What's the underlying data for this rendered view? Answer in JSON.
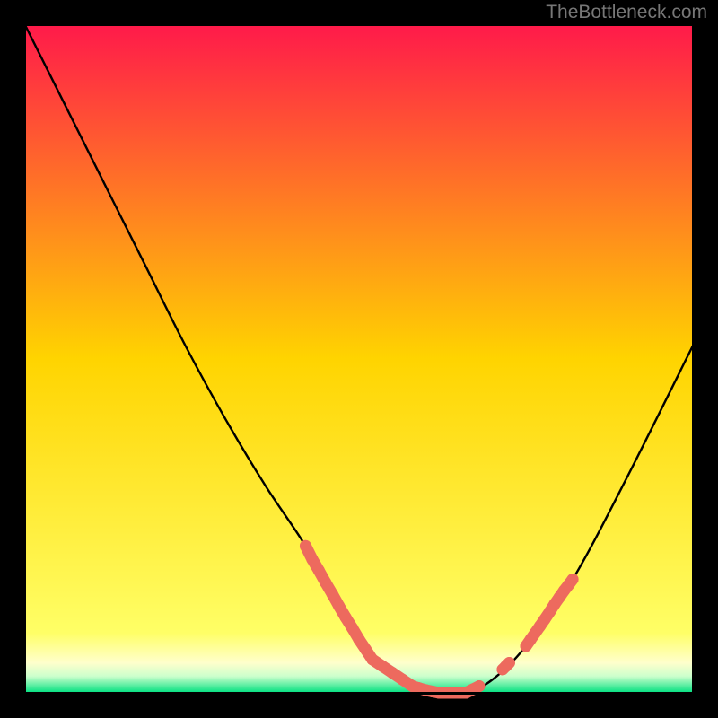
{
  "attribution": "TheBottleneck.com",
  "chart_data": {
    "type": "line",
    "title": "",
    "xlabel": "",
    "ylabel": "",
    "xlim": [
      0,
      100
    ],
    "ylim": [
      0,
      100
    ],
    "background_gradient": {
      "stops": [
        {
          "offset": 0.0,
          "color": "#ff1a4a"
        },
        {
          "offset": 0.5,
          "color": "#ffd400"
        },
        {
          "offset": 0.91,
          "color": "#ffff66"
        },
        {
          "offset": 0.955,
          "color": "#ffffcc"
        },
        {
          "offset": 0.975,
          "color": "#ccffcc"
        },
        {
          "offset": 1.0,
          "color": "#00e080"
        }
      ]
    },
    "series": [
      {
        "name": "bottleneck-curve",
        "x": [
          0,
          6,
          12,
          18,
          24,
          30,
          36,
          42,
          47,
          50,
          52,
          58,
          62,
          66,
          70,
          75,
          82,
          90,
          100
        ],
        "y": [
          100,
          88,
          76,
          64,
          52,
          41,
          31,
          22,
          13,
          8,
          5,
          1,
          0,
          0,
          2,
          7,
          17,
          32,
          52
        ]
      }
    ],
    "markers": {
      "name": "highlight-points",
      "color": "#ed6a5e",
      "clusters": [
        {
          "points": [
            {
              "x": 42,
              "y": 22
            },
            {
              "x": 43,
              "y": 20
            },
            {
              "x": 44,
              "y": 18.3
            },
            {
              "x": 45,
              "y": 16.5
            },
            {
              "x": 46,
              "y": 14.8
            },
            {
              "x": 47,
              "y": 13
            },
            {
              "x": 48,
              "y": 11.3
            },
            {
              "x": 49,
              "y": 9.7
            },
            {
              "x": 50,
              "y": 8
            },
            {
              "x": 51,
              "y": 6.5
            },
            {
              "x": 52,
              "y": 5
            },
            {
              "x": 53.5,
              "y": 4
            },
            {
              "x": 55,
              "y": 3
            },
            {
              "x": 56.5,
              "y": 2
            },
            {
              "x": 58,
              "y": 1
            }
          ]
        },
        {
          "points": [
            {
              "x": 58,
              "y": 1
            },
            {
              "x": 59,
              "y": 0.7
            },
            {
              "x": 60,
              "y": 0.4
            },
            {
              "x": 61,
              "y": 0.2
            },
            {
              "x": 62,
              "y": 0
            },
            {
              "x": 63,
              "y": 0
            },
            {
              "x": 64,
              "y": 0
            },
            {
              "x": 65,
              "y": 0
            },
            {
              "x": 66,
              "y": 0
            },
            {
              "x": 67,
              "y": 0.5
            },
            {
              "x": 68,
              "y": 1
            }
          ]
        },
        {
          "points": [
            {
              "x": 71.5,
              "y": 3.5
            },
            {
              "x": 72,
              "y": 4
            },
            {
              "x": 72.5,
              "y": 4.5
            }
          ]
        },
        {
          "points": [
            {
              "x": 75,
              "y": 7
            },
            {
              "x": 75.7,
              "y": 8
            },
            {
              "x": 76.4,
              "y": 9
            },
            {
              "x": 77.1,
              "y": 10
            },
            {
              "x": 77.8,
              "y": 11
            },
            {
              "x": 78.6,
              "y": 12.2
            },
            {
              "x": 79.3,
              "y": 13.3
            },
            {
              "x": 80,
              "y": 14.3
            },
            {
              "x": 80.7,
              "y": 15.3
            },
            {
              "x": 81.4,
              "y": 16.2
            },
            {
              "x": 82,
              "y": 17
            }
          ]
        }
      ]
    }
  }
}
